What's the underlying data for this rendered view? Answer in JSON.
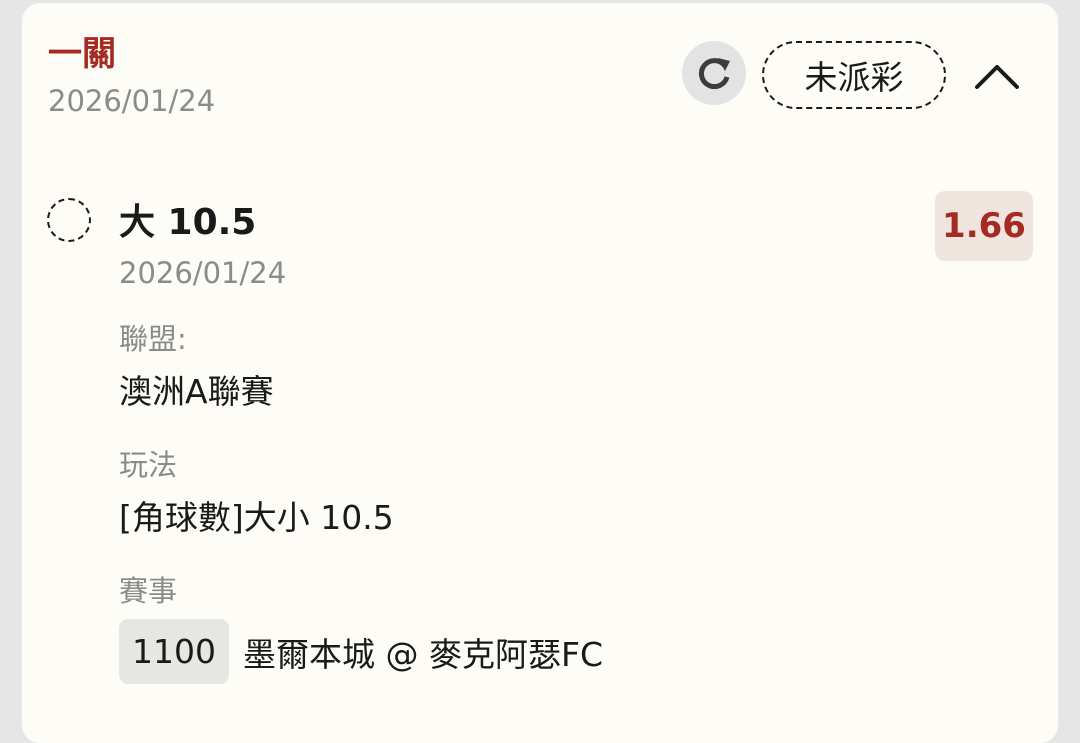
{
  "header": {
    "title": "一關",
    "date": "2026/01/24",
    "status": "未派彩",
    "icons": [
      "refresh-icon",
      "chevron-up-icon"
    ]
  },
  "selection": {
    "name": "大 10.5",
    "date": "2026/01/24",
    "odds": "1.66",
    "league_label": "聯盟:",
    "league_value": "澳洲A聯賽",
    "bet_type_label": "玩法",
    "bet_type_value": "[角球數]大小 10.5",
    "match_label": "賽事",
    "match_code": "1100",
    "match_name": "墨爾本城 @ 麥克阿瑟FC"
  },
  "colors": {
    "accent": "#a52a22",
    "card_bg": "#fdfcf6",
    "odds_bg": "#f0e5de",
    "muted_text": "#8b8b8b"
  }
}
